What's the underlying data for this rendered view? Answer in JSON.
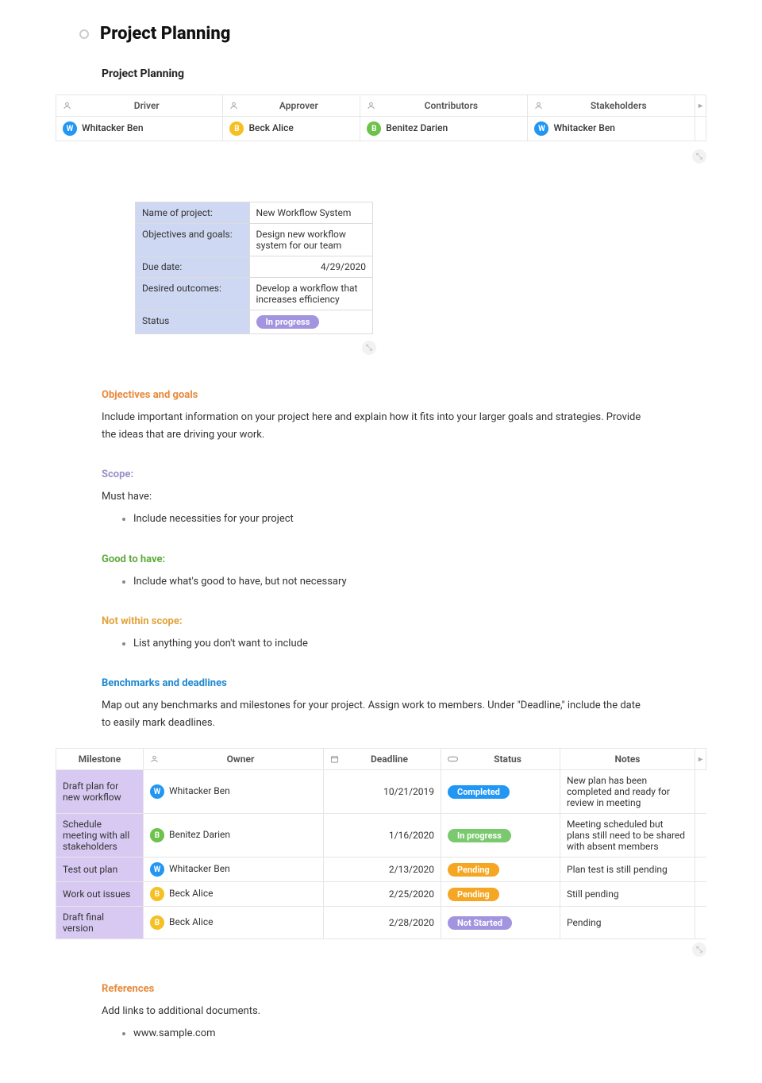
{
  "page": {
    "title": "Project Planning",
    "subtitle": "Project Planning"
  },
  "roles": {
    "headers": [
      "Driver",
      "Approver",
      "Contributors",
      "Stakeholders"
    ],
    "row": [
      {
        "initial": "W",
        "color": "blue",
        "name": "Whitacker Ben"
      },
      {
        "initial": "B",
        "color": "yellow",
        "name": "Beck Alice"
      },
      {
        "initial": "B",
        "color": "green",
        "name": "Benitez Darien"
      },
      {
        "initial": "W",
        "color": "blue",
        "name": "Whitacker Ben"
      }
    ]
  },
  "info": {
    "rows": [
      {
        "label": "Name of project:",
        "value": "New Workflow System"
      },
      {
        "label": "Objectives and goals:",
        "value": "Design new workflow system for our team"
      },
      {
        "label": "Due date:",
        "value": "4/29/2020",
        "align": "right"
      },
      {
        "label": "Desired outcomes:",
        "value": "Develop a workflow that increases efficiency"
      },
      {
        "label": "Status",
        "value": "In progress",
        "pill": "purple"
      }
    ]
  },
  "sections": {
    "objectives": {
      "heading": "Objectives and goals",
      "text": "Include important information on your project here and explain how it fits into your larger goals and strategies. Provide the ideas that are driving your work."
    },
    "scope": {
      "heading": "Scope:",
      "must_have_label": "Must have:",
      "must_have_bullet": "Include necessities for your project"
    },
    "good": {
      "heading": "Good to have:",
      "bullet": "Include what's good to have, but not necessary"
    },
    "not_scope": {
      "heading": "Not within scope:",
      "bullet": "List anything you don't want to include"
    },
    "benchmarks": {
      "heading": "Benchmarks and deadlines",
      "text": "Map out any benchmarks and milestones for your project. Assign work to members. Under \"Deadline,\" include the date to easily mark deadlines."
    },
    "references": {
      "heading": "References",
      "text": "Add links to additional documents.",
      "bullet": "www.sample.com"
    }
  },
  "milestones": {
    "headers": [
      "Milestone",
      "Owner",
      "Deadline",
      "Status",
      "Notes"
    ],
    "rows": [
      {
        "milestone": "Draft plan for new workflow",
        "owner": {
          "initial": "W",
          "color": "blue",
          "name": "Whitacker Ben"
        },
        "deadline": "10/21/2019",
        "status": {
          "label": "Completed",
          "pill": "blue"
        },
        "notes": "New plan has been completed and ready for review in meeting"
      },
      {
        "milestone": "Schedule meeting with all stakeholders",
        "owner": {
          "initial": "B",
          "color": "green",
          "name": "Benitez Darien"
        },
        "deadline": "1/16/2020",
        "status": {
          "label": "In progress",
          "pill": "green"
        },
        "notes": "Meeting scheduled but plans still need to be shared with absent members"
      },
      {
        "milestone": "Test out plan",
        "owner": {
          "initial": "W",
          "color": "blue",
          "name": "Whitacker Ben"
        },
        "deadline": "2/13/2020",
        "status": {
          "label": "Pending",
          "pill": "orange"
        },
        "notes": "Plan test is still pending"
      },
      {
        "milestone": "Work out issues",
        "owner": {
          "initial": "B",
          "color": "yellow",
          "name": "Beck Alice"
        },
        "deadline": "2/25/2020",
        "status": {
          "label": "Pending",
          "pill": "orange"
        },
        "notes": "Still pending"
      },
      {
        "milestone": "Draft final version",
        "owner": {
          "initial": "B",
          "color": "yellow",
          "name": "Beck Alice"
        },
        "deadline": "2/28/2020",
        "status": {
          "label": "Not Started",
          "pill": "purple"
        },
        "notes": "Pending"
      }
    ]
  }
}
